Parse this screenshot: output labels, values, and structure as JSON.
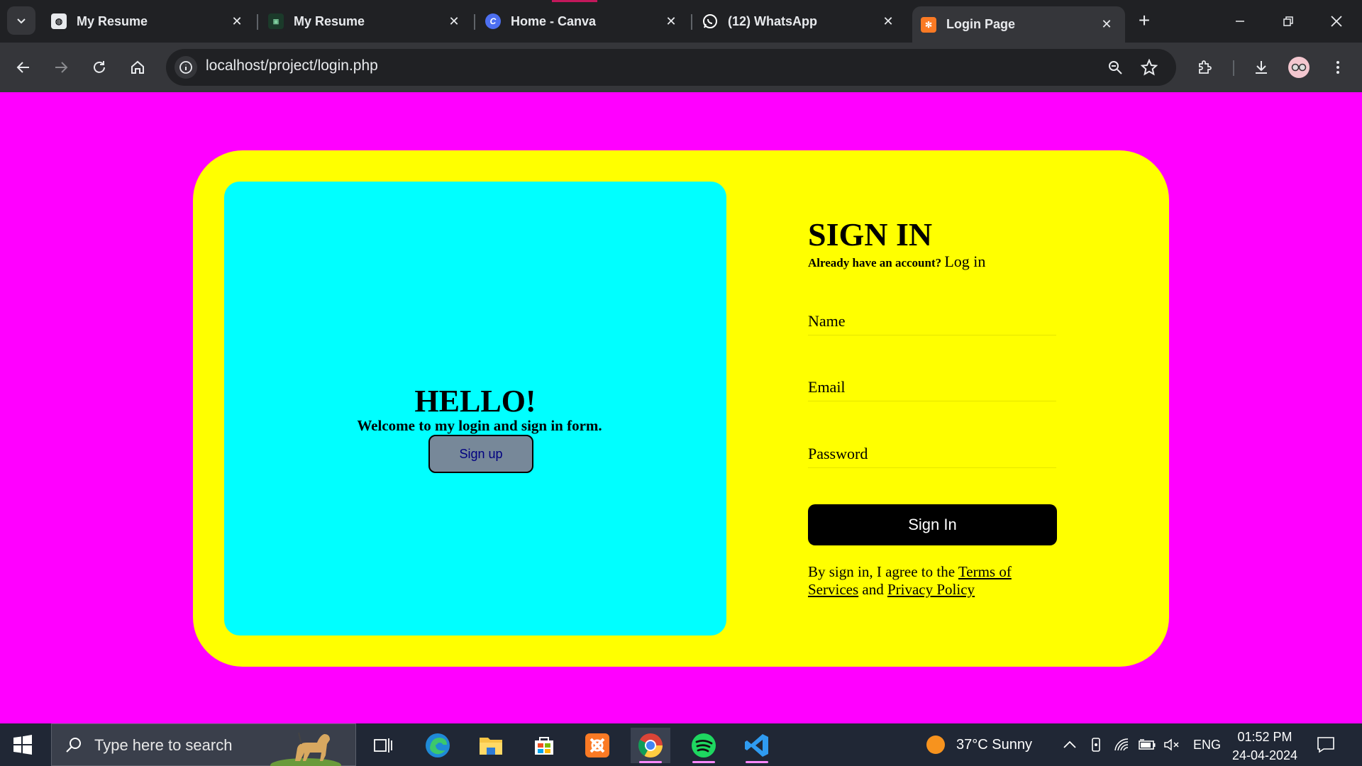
{
  "browser": {
    "tabs": [
      {
        "title": "My Resume",
        "favicon": "resume-favicon"
      },
      {
        "title": "My Resume",
        "favicon": "resume-favicon-dark"
      },
      {
        "title": "Home - Canva",
        "favicon": "canva-favicon"
      },
      {
        "title": "(12) WhatsApp",
        "favicon": "whatsapp-favicon"
      },
      {
        "title": "Login Page",
        "favicon": "xampp-favicon",
        "active": true
      }
    ],
    "url": "localhost/project/login.php"
  },
  "page": {
    "background": "#ff00ff",
    "card_color": "#ffff00",
    "panel_color": "#00ffff",
    "left": {
      "heading": "HELLO!",
      "subtext": "Welcome to my login and sign in form.",
      "signup_label": "Sign up"
    },
    "right": {
      "title": "SIGN IN",
      "already_text": "Already have an account?",
      "login_link": "Log in",
      "name_placeholder": "Name",
      "email_placeholder": "Email",
      "password_placeholder": "Password",
      "signin_label": "Sign In",
      "terms_prefix": "By sign in, I agree to the",
      "terms_link": "Terms of Services",
      "terms_and": "and",
      "privacy_link": "Privacy Policy"
    }
  },
  "taskbar": {
    "search_placeholder": "Type here to search",
    "weather": "37°C  Sunny",
    "language": "ENG",
    "time": "01:52 PM",
    "date": "24-04-2024"
  }
}
